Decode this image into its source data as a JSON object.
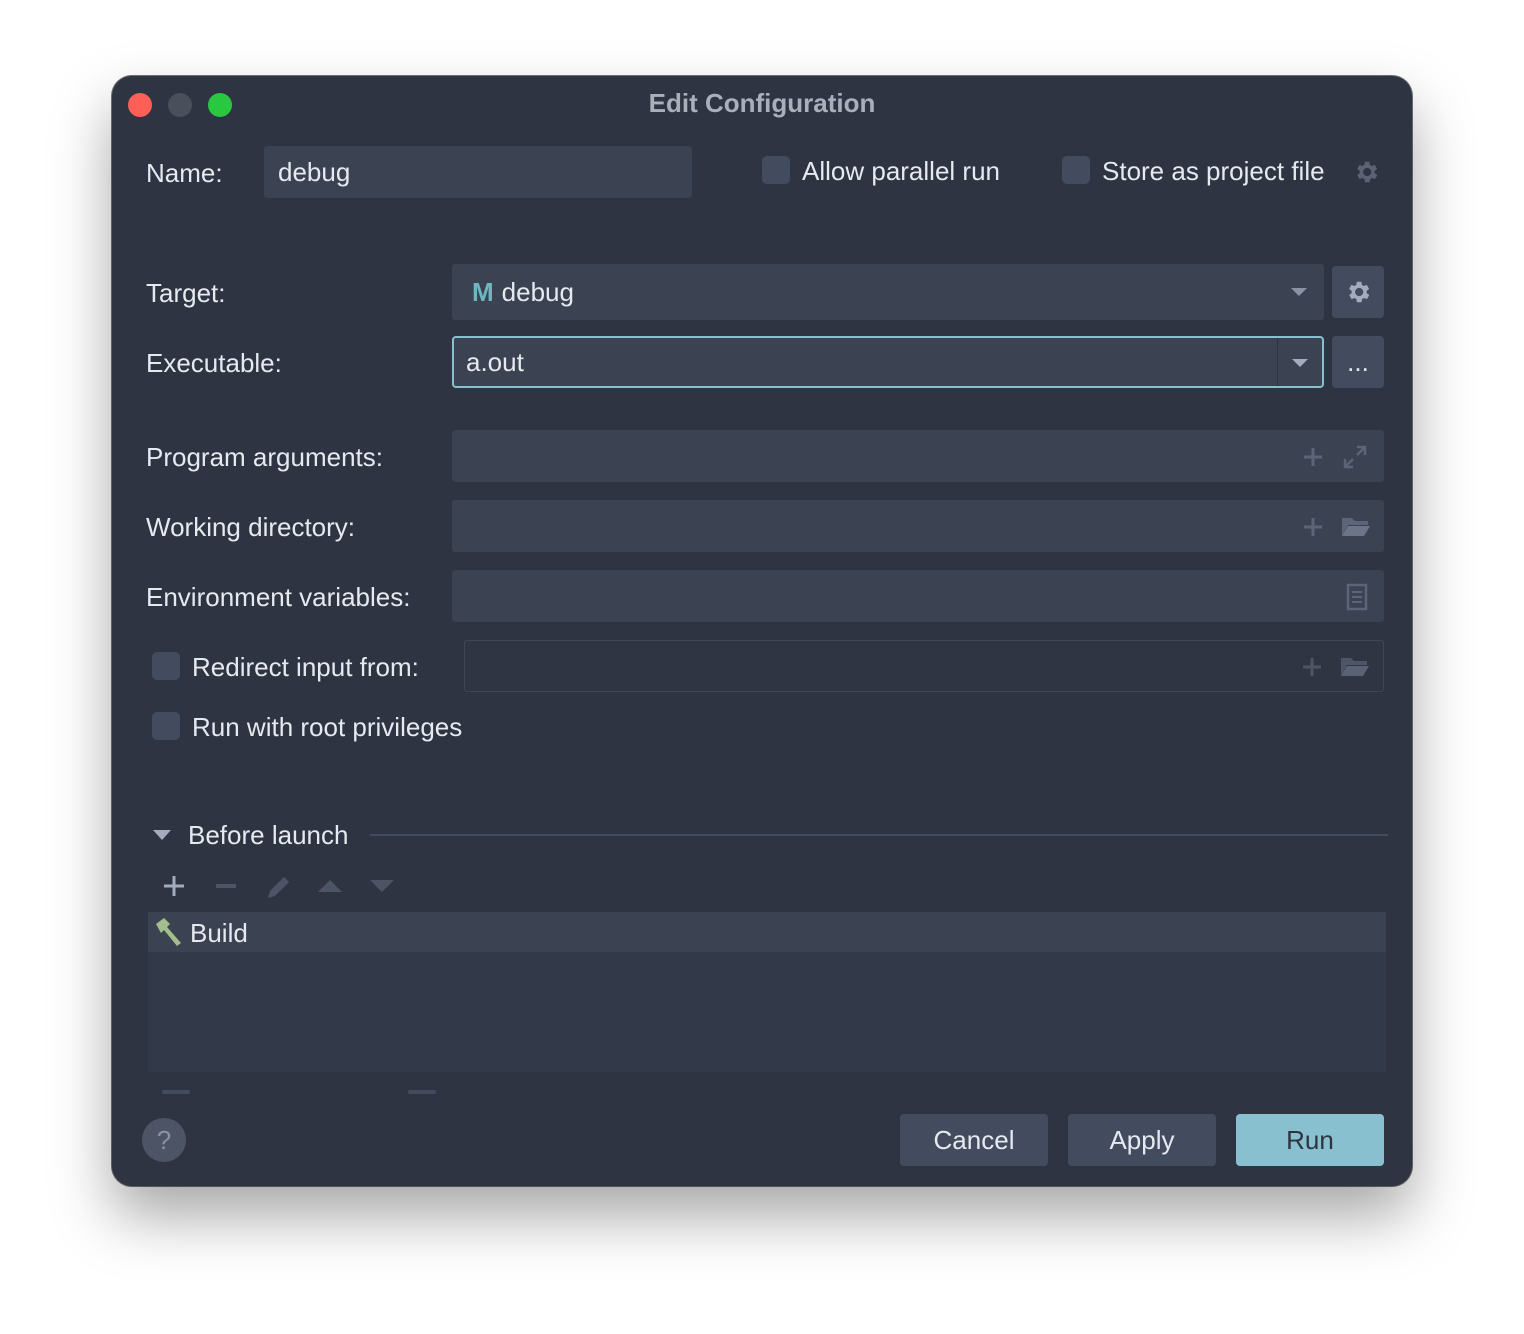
{
  "window": {
    "title": "Edit Configuration"
  },
  "name": {
    "label": "Name:",
    "value": "debug"
  },
  "options": {
    "allow_parallel_run": {
      "label": "Allow parallel run",
      "checked": false
    },
    "store_as_project_file": {
      "label": "Store as project file",
      "checked": false
    }
  },
  "target": {
    "label": "Target:",
    "badge": "M",
    "value": "debug"
  },
  "executable": {
    "label": "Executable:",
    "value": "a.out",
    "browse_label": "..."
  },
  "program_arguments": {
    "label": "Program arguments:",
    "value": ""
  },
  "working_directory": {
    "label": "Working directory:",
    "value": ""
  },
  "environment_variables": {
    "label": "Environment variables:",
    "value": ""
  },
  "redirect_input": {
    "label": "Redirect input from:",
    "checked": false,
    "value": ""
  },
  "root_privileges": {
    "label": "Run with root privileges",
    "checked": false
  },
  "before_launch": {
    "title": "Before launch",
    "tasks": [
      {
        "label": "Build",
        "icon": "hammer-icon"
      }
    ]
  },
  "footer": {
    "help_label": "?",
    "cancel_label": "Cancel",
    "apply_label": "Apply",
    "run_label": "Run"
  },
  "colors": {
    "window_bg": "#2e3441",
    "field_bg": "#3b4252",
    "accent": "#88c0d0",
    "focus_border": "#88c0d0"
  }
}
